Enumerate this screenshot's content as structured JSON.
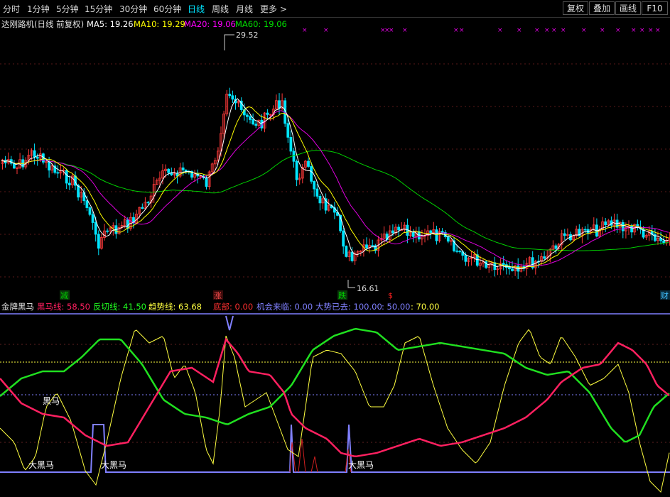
{
  "toolbar": {
    "tabs": [
      {
        "label": "分时",
        "active": false
      },
      {
        "label": "1分钟",
        "active": false
      },
      {
        "label": "5分钟",
        "active": false
      },
      {
        "label": "15分钟",
        "active": false
      },
      {
        "label": "30分钟",
        "active": false
      },
      {
        "label": "60分钟",
        "active": false
      },
      {
        "label": "日线",
        "active": true
      },
      {
        "label": "周线",
        "active": false
      },
      {
        "label": "月线",
        "active": false
      },
      {
        "label": "更多",
        "active": false
      }
    ],
    "more_arrow": ">",
    "right_buttons": [
      "复权",
      "叠加",
      "画线",
      "F10"
    ]
  },
  "main": {
    "title": "达刚路机(日线 前复权)",
    "ma": [
      {
        "label": "MA5: 19.26",
        "color": "#ffffff"
      },
      {
        "label": "MA10: 19.29",
        "color": "#ffff00"
      },
      {
        "label": "MA20: 19.06",
        "color": "#ff00ff"
      },
      {
        "label": "MA60: 19.06",
        "color": "#00e000"
      }
    ],
    "high_label": "29.52",
    "low_label": "16.61",
    "signals": [
      {
        "text": "减",
        "color": "#00c000"
      },
      {
        "text": "涨",
        "color": "#ff4040"
      },
      {
        "text": "跌",
        "color": "#00c000"
      },
      {
        "text": "$",
        "color": "#ff2020"
      },
      {
        "text": "财",
        "color": "#40c0ff"
      }
    ],
    "top_mark": "×"
  },
  "sub": {
    "title": "金牌黑马",
    "legend": [
      {
        "label": "黑马线: 58.50",
        "color": "#ff2060"
      },
      {
        "label": "反切线: 41.50",
        "color": "#20ff20"
      },
      {
        "label": "趋势线: 63.68",
        "color": "#ffff40"
      },
      {
        "label": "底部: 0.00",
        "color": "#ff3030"
      },
      {
        "label": "机会来临: 0.00",
        "color": "#8080ff"
      },
      {
        "label": "大势已去: 100.00",
        "color": "#8080ff"
      },
      {
        "label": ": 50.00",
        "color": "#8080ff"
      },
      {
        "label": ": 70.00",
        "color": "#ffff40"
      }
    ],
    "annotations": [
      "黑马",
      "大黑马",
      "大黑马",
      "大黑马"
    ]
  },
  "colors": {
    "up": "#ff3a3a",
    "down": "#00e5ff",
    "background": "#000000"
  }
}
